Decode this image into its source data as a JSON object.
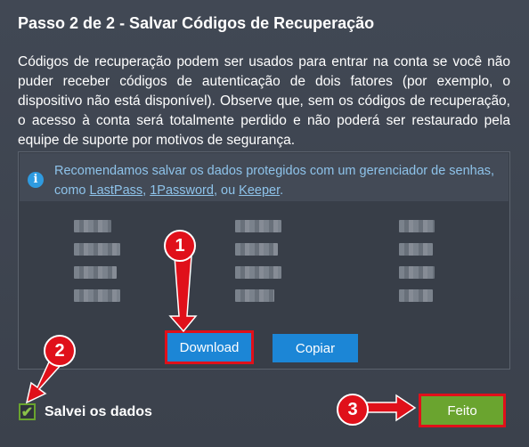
{
  "dialog": {
    "title": "Passo 2 de 2 - Salvar Códigos de Recuperação",
    "description": "Códigos de recuperação podem ser usados para entrar na conta se você não puder receber códigos de autenticação de dois fatores (por exemplo, o dispositivo não está disponível). Observe que, sem os códigos de recuperação, o acesso à conta será totalmente perdido e não poderá ser restaurado pela equipe de suporte por motivos de segurança."
  },
  "info": {
    "icon": "info-icon",
    "text_before": "Recomendamos salvar os dados protegidos com um gerenciador de senhas, como ",
    "link1": "LastPass",
    "sep1": ", ",
    "link2": "1Password",
    "sep2": ", ou ",
    "link3": "Keeper",
    "text_after": "."
  },
  "buttons": {
    "download": "Download",
    "copy": "Copiar",
    "done": "Feito"
  },
  "checkbox": {
    "label": "Salvei os dados",
    "checked": true
  },
  "markers": [
    "1",
    "2",
    "3"
  ],
  "colors": {
    "background": "#3b414c",
    "primary_button": "#1c86d6",
    "done_button": "#6aa42f",
    "highlight": "#e0101a",
    "info_text": "#8ec3ea"
  }
}
